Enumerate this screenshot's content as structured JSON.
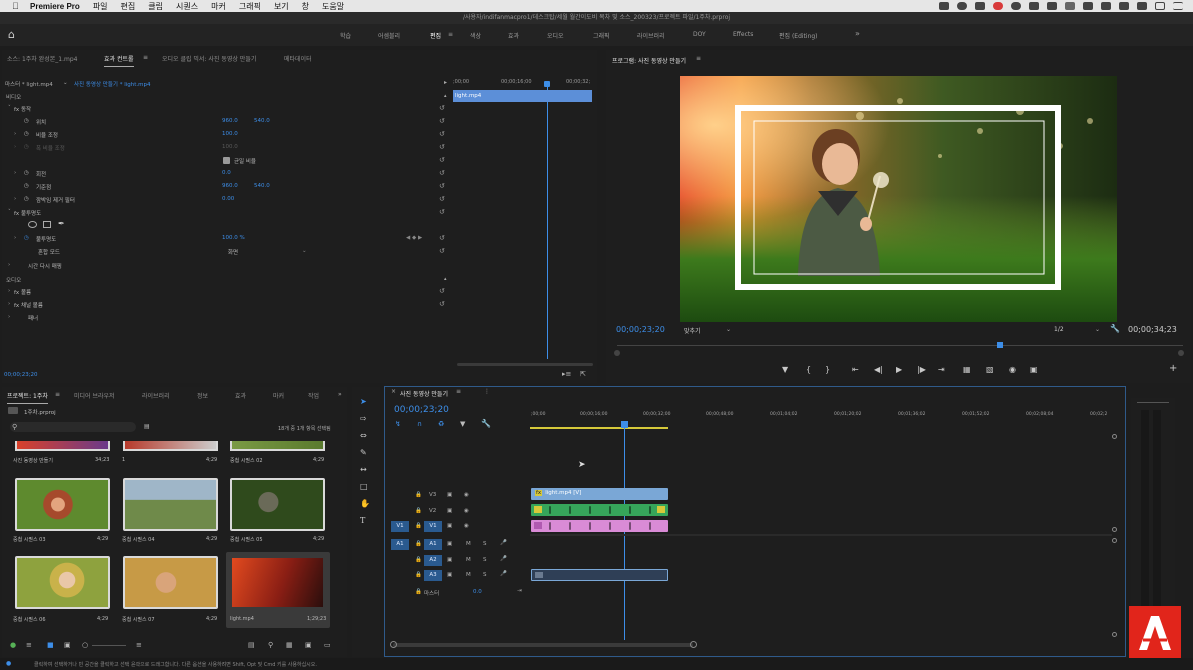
{
  "menubar": {
    "app": "Premiere Pro",
    "items": [
      "파일",
      "편집",
      "클립",
      "시퀀스",
      "마커",
      "그래픽",
      "보기",
      "창",
      "도움말"
    ]
  },
  "titlebar": {
    "path": "/사용자/indifanmacpro1/데스크탑/세월 월간이도비 목차 및 소스_200323/프로젝트 파일/1주차.prproj"
  },
  "workspace": {
    "tabs": [
      "학습",
      "어셈블리",
      "편집",
      "색상",
      "효과",
      "오디오",
      "그래픽",
      "라이브러리",
      "DOY",
      "Effects",
      "편집 (Editing)"
    ],
    "active": "편집",
    "more": "»"
  },
  "source_panel": {
    "tabs": [
      "소스: 1주차 완성본_1.mp4",
      "효과 컨트롤",
      "오디오 클립 믹서: 사진 동영상 만들기",
      "메타데이터"
    ],
    "active_tab": "효과 컨트롤",
    "master_label": "마스터 * light.mp4",
    "sequence_label": "사진 동영상 만들기 * light.mp4",
    "timecode": "00;00;23;20",
    "mini_timeline": {
      "t0": ";00;00",
      "t1": "00;00;16;00",
      "t2": "00;00;32;",
      "clip": "light.mp4"
    }
  },
  "effect_controls": {
    "video_header": "비디오",
    "audio_header": "오디오",
    "rows": [
      {
        "label": "fx  동작",
        "v1": "",
        "v2": ""
      },
      {
        "label": "위치",
        "v1": "960.0",
        "v2": "540.0"
      },
      {
        "label": "비율 조정",
        "v1": "100.0",
        "v2": ""
      },
      {
        "label": "폭 비율 조정",
        "v1": "100.0",
        "v2": ""
      },
      {
        "label": "균일 비율",
        "v1": "",
        "v2": ""
      },
      {
        "label": "회전",
        "v1": "0.0",
        "v2": ""
      },
      {
        "label": "기준점",
        "v1": "960.0",
        "v2": "540.0"
      },
      {
        "label": "깜박임 제거 필터",
        "v1": "0.00",
        "v2": ""
      },
      {
        "label": "fx  불투명도",
        "v1": "",
        "v2": ""
      },
      {
        "label": "불투명도",
        "v1": "100.0 %",
        "v2": ""
      },
      {
        "label": "혼합 모드",
        "v1": "화면",
        "v2": ""
      },
      {
        "label": "시간 다시 매핑",
        "v1": "",
        "v2": ""
      }
    ],
    "audio_rows": [
      "fx  볼륨",
      "fx  채널 볼륨",
      "패너"
    ]
  },
  "program_monitor": {
    "title": "프로그램: 사진 동영상 만들기",
    "timecode": "00;00;23;20",
    "fit": "맞추기",
    "quality": "1/2",
    "duration": "00;00;34;23"
  },
  "project_panel": {
    "tabs": [
      "프로젝트: 1주차",
      "미디어 브라우저",
      "라이브러리",
      "정보",
      "효과",
      "마커",
      "작업"
    ],
    "file": "1주차.prproj",
    "selection": "18개 중 1개 항목 선택됨",
    "top_items": [
      {
        "name": "사진 동영상 만들기",
        "dur": "34;23"
      },
      {
        "name": "1",
        "dur": "4;29"
      },
      {
        "name": "중첩 시퀀스 02",
        "dur": "4;29"
      }
    ],
    "items": [
      {
        "name": "중첩 시퀀스 03",
        "dur": "4;29"
      },
      {
        "name": "중첩 시퀀스 04",
        "dur": "4;29"
      },
      {
        "name": "중첩 시퀀스 05",
        "dur": "4;29"
      },
      {
        "name": "중첩 시퀀스 06",
        "dur": "4;29"
      },
      {
        "name": "중첩 시퀀스 07",
        "dur": "4;29"
      },
      {
        "name": "light.mp4",
        "dur": "1;29;23"
      }
    ]
  },
  "timeline": {
    "tab": "사진 동영상 만들기",
    "timecode": "00;00;23;20",
    "ruler": [
      ";00;00",
      "00;00;16;00",
      "00;00;32;00",
      "00;00;48;00",
      "00;01;04;02",
      "00;01;20;02",
      "00;01;36;02",
      "00;01;52;02",
      "00;02;08;04",
      "00;02;2"
    ],
    "tracks_video": [
      "V3",
      "V2",
      "V1"
    ],
    "tracks_audio": [
      "A1",
      "A2",
      "A3"
    ],
    "master": "마스터",
    "master_val": "0.0",
    "clip_v3": "light.mp4 [V]",
    "mute": "M",
    "solo": "S",
    "src_v1": "V1",
    "src_a1": "A1"
  },
  "status_bar": "클릭하여 선택하거나 빈 공간을 클릭하고 선택 윤곽으로 드래그합니다. 다른 옵션을 사용하려면 Shift, Opt 및 Cmd 키를 사용하십시오.",
  "colors": {
    "accent": "#3d8ee8",
    "clip_pink": "#d98bd6",
    "clip_green": "#36a55a",
    "clip_blue": "#7aa7d6",
    "adobe_red": "#e1251b"
  }
}
